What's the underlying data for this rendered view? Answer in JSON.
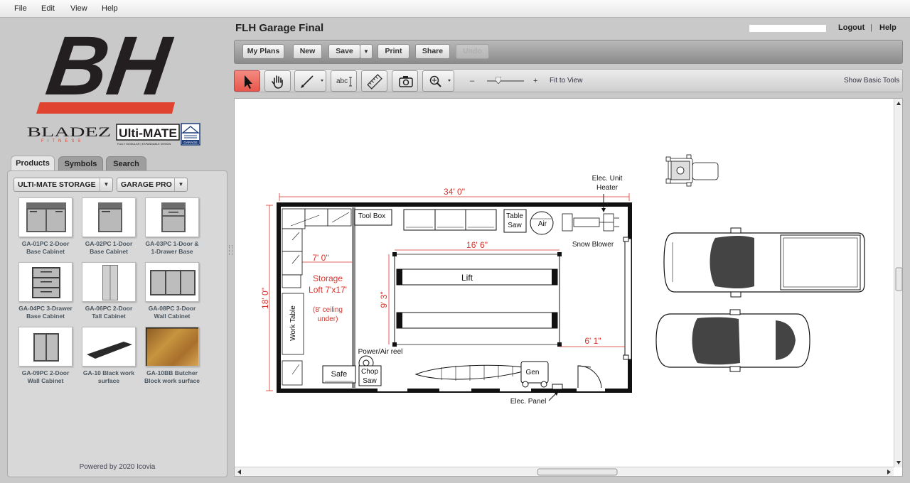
{
  "menu": {
    "file": "File",
    "edit": "Edit",
    "view": "View",
    "help": "Help"
  },
  "brand": {
    "logo_text": "BH",
    "bladez": "BLADEZ",
    "fitness": "FITNESS",
    "ultimate": "Ulti-MATE",
    "ultimate_tagline": "FULLY MODULAR | EXPANDABLE DESIGN",
    "garage": "GARAGE",
    "accent_color": "#e0432f"
  },
  "tabs": {
    "products": "Products",
    "symbols": "Symbols",
    "search": "Search"
  },
  "filters": {
    "storage": "ULTI-MATE STORAGE",
    "series": "GARAGE PRO"
  },
  "products": [
    {
      "line1": "GA-01PC 2-Door",
      "line2": "Base Cabinet"
    },
    {
      "line1": "GA-02PC 1-Door",
      "line2": "Base Cabinet"
    },
    {
      "line1": "GA-03PC 1-Door &",
      "line2": "1-Drawer Base"
    },
    {
      "line1": "GA-04PC 3-Drawer",
      "line2": "Base Cabinet"
    },
    {
      "line1": "GA-06PC 2-Door",
      "line2": "Tall Cabinet"
    },
    {
      "line1": "GA-08PC 3-Door",
      "line2": "Wall Cabinet"
    },
    {
      "line1": "GA-09PC 2-Door",
      "line2": "Wall Cabinet"
    },
    {
      "line1": "GA-10 Black work",
      "line2": "surface"
    },
    {
      "line1": "GA-10BB Butcher",
      "line2": "Block work surface"
    }
  ],
  "powered_by": "Powered by 2020 Icovia",
  "header": {
    "title": "FLH Garage Final",
    "logout": "Logout",
    "separator": "|",
    "help": "Help"
  },
  "toolbar": {
    "my_plans": "My Plans",
    "new": "New",
    "save": "Save",
    "print": "Print",
    "share": "Share",
    "undo": "Undo"
  },
  "tools": {
    "text_tool": "abc",
    "zoom_minus": "–",
    "zoom_plus": "+",
    "fit_to_view": "Fit to View",
    "show_basic_tools": "Show Basic Tools"
  },
  "plan": {
    "width_dim": "34' 0\"",
    "depth_dim": "18' 0\"",
    "loft_dim": "7' 0\"",
    "lift_dim": "16' 6\"",
    "lift_depth_dim": "9' 3\"",
    "side_dim": "6' 1\"",
    "loft_l1": "Storage",
    "loft_l2": "Loft 7'x17'",
    "loft_l3": "(8' ceiling",
    "loft_l4": "under)",
    "tool_box": "Tool Box",
    "table_saw_1": "Table",
    "table_saw_2": "Saw",
    "air": "Air",
    "elec_heater_1": "Elec. Unit",
    "elec_heater_2": "Heater",
    "snow_blower": "Snow Blower",
    "lift": "Lift",
    "work_table": "Work Table",
    "power_air_reel": "Power/Air reel",
    "safe": "Safe",
    "chop_saw_1": "Chop",
    "chop_saw_2": "Saw",
    "gen": "Gen",
    "elec_panel": "Elec. Panel",
    "dim_color": "#d9322a"
  }
}
